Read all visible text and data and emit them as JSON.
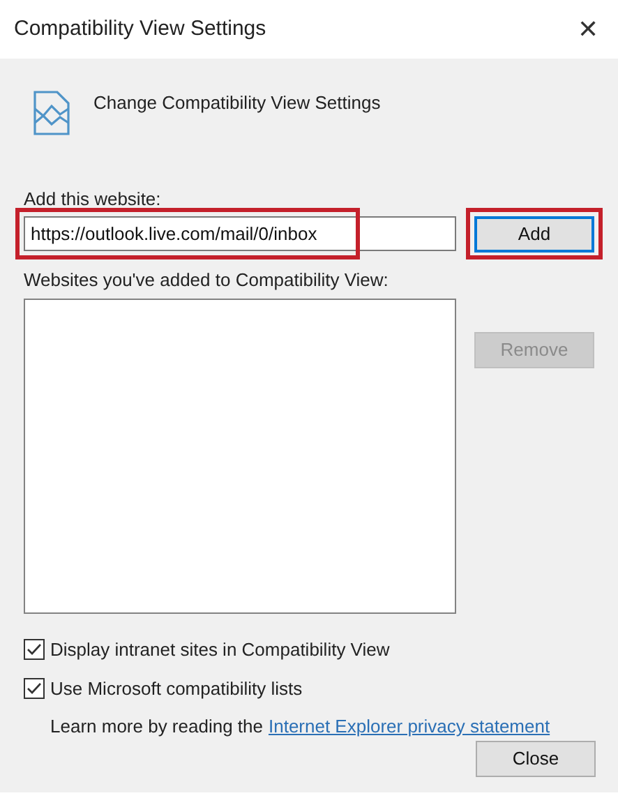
{
  "window": {
    "title": "Compatibility View Settings",
    "close_glyph": "✕"
  },
  "heading": "Change Compatibility View Settings",
  "add_website": {
    "label": "Add this website:",
    "value": "https://outlook.live.com/mail/0/inbox",
    "highlighted": true
  },
  "add_button": {
    "label": "Add",
    "highlighted": true,
    "disabled": false
  },
  "list": {
    "label": "Websites you've added to Compatibility View:"
  },
  "remove_button": {
    "label": "Remove",
    "disabled": true
  },
  "options": [
    {
      "label": "Display intranet sites in Compatibility View",
      "checked": true
    },
    {
      "label": "Use Microsoft compatibility lists",
      "checked": true
    }
  ],
  "learn_more": {
    "text": "Learn more by reading the",
    "link": "Internet Explorer privacy statement"
  },
  "close_button": {
    "label": "Close"
  }
}
